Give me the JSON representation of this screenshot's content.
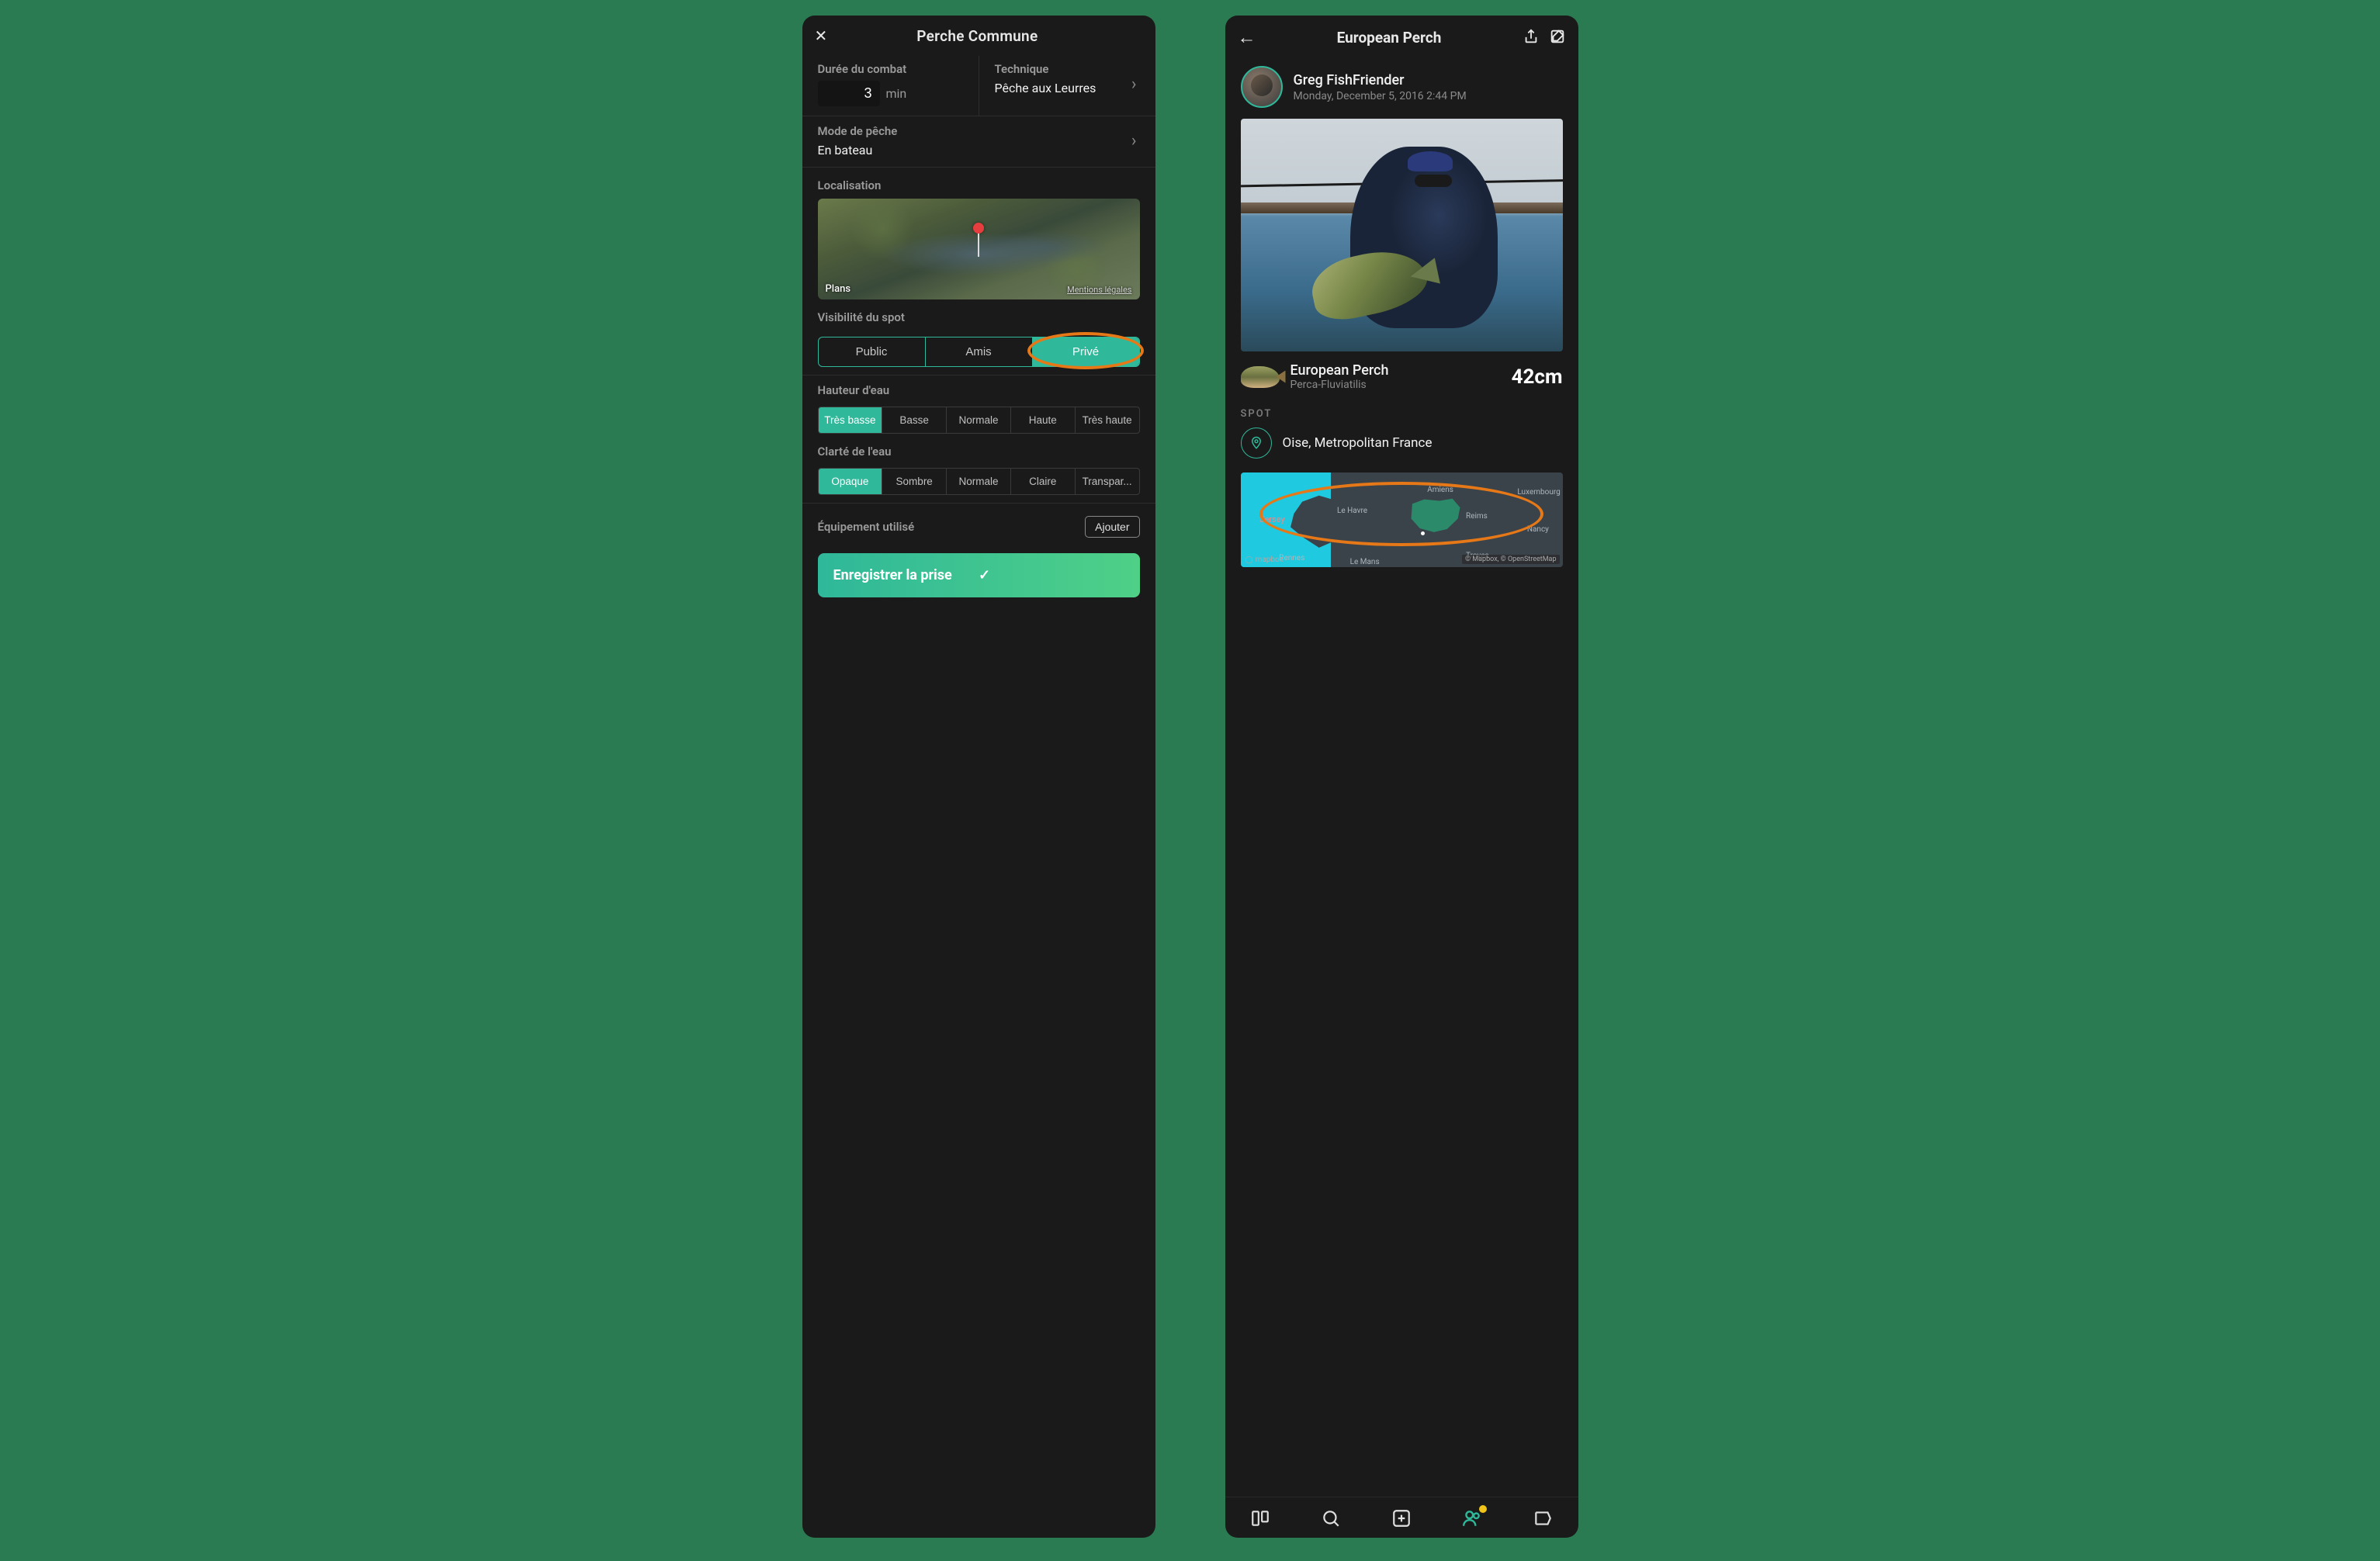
{
  "phone1": {
    "title": "Perche Commune",
    "fightDuration": {
      "label": "Durée du combat",
      "value": "3",
      "unit": "min"
    },
    "technique": {
      "label": "Technique",
      "value": "Pêche aux Leurres"
    },
    "mode": {
      "label": "Mode de pêche",
      "value": "En bateau"
    },
    "localisation": {
      "label": "Localisation",
      "provider": "Plans",
      "legal": "Mentions légales"
    },
    "visibility": {
      "label": "Visibilité du spot",
      "options": [
        "Public",
        "Amis",
        "Privé"
      ],
      "selected": 2
    },
    "waterHeight": {
      "label": "Hauteur d'eau",
      "options": [
        "Très basse",
        "Basse",
        "Normale",
        "Haute",
        "Très haute"
      ],
      "selected": 0
    },
    "waterClarity": {
      "label": "Clarté de l'eau",
      "options": [
        "Opaque",
        "Sombre",
        "Normale",
        "Claire",
        "Transpar..."
      ],
      "selected": 0
    },
    "equipment": {
      "label": "Équipement utilisé",
      "addLabel": "Ajouter"
    },
    "save": "Enregistrer la prise"
  },
  "phone2": {
    "title": "European Perch",
    "user": {
      "name": "Greg FishFriender",
      "date": "Monday, December 5, 2016 2:44 PM"
    },
    "species": {
      "common": "European Perch",
      "latin": "Perca-Fluviatilis",
      "size": "42cm"
    },
    "spot": {
      "sectionLabel": "SPOT",
      "name": "Oise, Metropolitan France"
    },
    "map": {
      "provider": "mapbox",
      "attribution": "© Mapbox, © OpenStreetMap",
      "labels": {
        "jersey": "Jersey",
        "lehavre": "Le Havre",
        "amiens": "Amiens",
        "reims": "Reims",
        "nancy": "Nancy",
        "rennes": "Rennes",
        "lemans": "Le Mans",
        "troyes": "Troyes",
        "lux": "Luxembourg"
      }
    }
  }
}
